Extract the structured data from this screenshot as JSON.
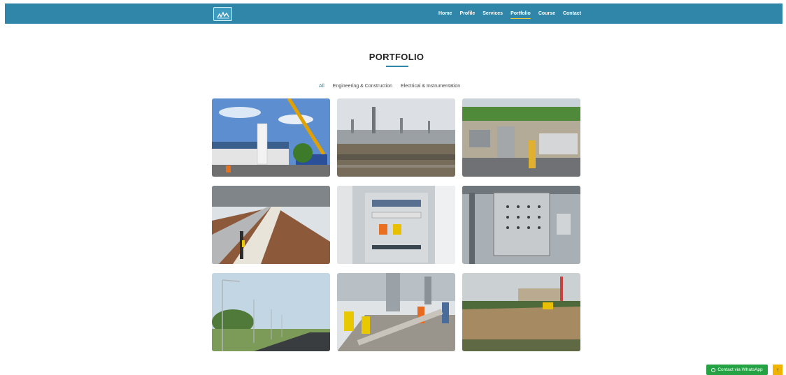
{
  "nav": {
    "links": [
      {
        "label": "Home"
      },
      {
        "label": "Profile"
      },
      {
        "label": "Services"
      },
      {
        "label": "Portfolio",
        "active": true
      },
      {
        "label": "Course"
      },
      {
        "label": "Contact"
      }
    ],
    "logo_icon": "company-logo"
  },
  "portfolio": {
    "title": "PORTFOLIO",
    "filters": [
      {
        "label": "All",
        "active": true
      },
      {
        "label": "Engineering & Construction"
      },
      {
        "label": "Electrical & Instrumentation"
      }
    ],
    "items": [
      {
        "subject": "crane-lifting-vessel"
      },
      {
        "subject": "refinery-site"
      },
      {
        "subject": "plant-aerial-view"
      },
      {
        "subject": "pipe-rack-trench"
      },
      {
        "subject": "electrical-panel"
      },
      {
        "subject": "instrument-cabinet"
      },
      {
        "subject": "street-lights-road"
      },
      {
        "subject": "concrete-pouring-workers"
      },
      {
        "subject": "land-clearing-site"
      }
    ]
  },
  "floating": {
    "whatsapp_label": "Contact via WhatsApp",
    "back_to_top_icon": "↑"
  },
  "colors": {
    "nav_bg": "#2f86a9",
    "accent": "#e8c840",
    "whatsapp": "#25a244",
    "back_to_top": "#f0b400"
  }
}
